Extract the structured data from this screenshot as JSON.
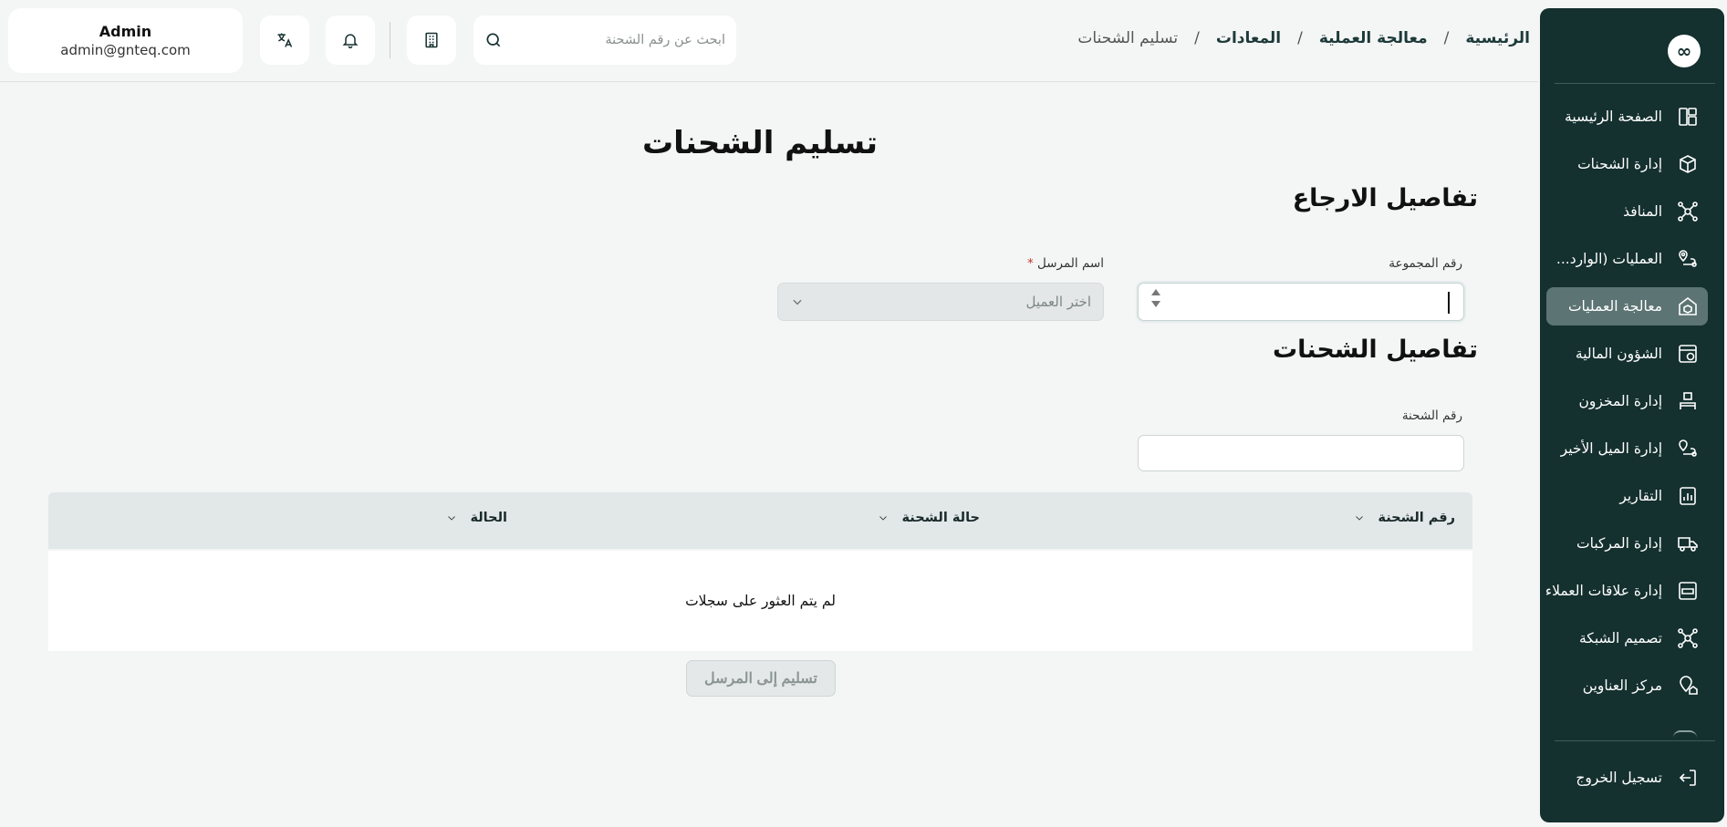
{
  "sidebar": {
    "logo": "∞",
    "items": [
      {
        "label": "الصفحة الرئيسية",
        "icon": "dashboard-icon"
      },
      {
        "label": "إدارة الشحنات",
        "icon": "package-icon"
      },
      {
        "label": "المنافذ",
        "icon": "network-icon"
      },
      {
        "label": "العمليات (الوارد...",
        "icon": "route-icon"
      },
      {
        "label": "معالجة العمليات",
        "icon": "box-gear-icon",
        "active": true
      },
      {
        "label": "الشؤون المالية",
        "icon": "finance-icon"
      },
      {
        "label": "إدارة المخزون",
        "icon": "warehouse-icon"
      },
      {
        "label": "إدارة الميل الأخير",
        "icon": "last-mile-icon"
      },
      {
        "label": "التقارير",
        "icon": "report-icon"
      },
      {
        "label": "إدارة المركبات",
        "icon": "truck-icon"
      },
      {
        "label": "إدارة علاقات العملاء",
        "icon": "crm-icon"
      },
      {
        "label": "تصميم الشبكة",
        "icon": "grid-network-icon"
      },
      {
        "label": "مركز العناوين",
        "icon": "address-icon"
      }
    ],
    "logout": "تسجيل الخروج"
  },
  "breadcrumb": [
    "الرئيسية",
    "معالجة العملية",
    "المعادات",
    "تسليم الشحنات"
  ],
  "search": {
    "placeholder": "ابحث عن رقم الشحنة"
  },
  "user": {
    "name": "Admin",
    "email": "admin@gnteq.com"
  },
  "page": {
    "title": "تسليم الشحنات",
    "return_section": "تفاصيل الارجاع",
    "group_number_label": "رقم المجموعة",
    "group_number_value": "",
    "sender_name_label": "اسم المرسل",
    "sender_required": "*",
    "sender_placeholder": "اختر العميل",
    "shipments_section": "تفاصيل الشحنات",
    "shipment_number_label": "رقم الشحنة",
    "table": {
      "columns": [
        "رقم الشحنة",
        "حالة الشحنة",
        "الحالة"
      ],
      "empty": "لم يتم العثور على سجلات"
    },
    "submit_label": "تسليم إلى المرسل"
  }
}
